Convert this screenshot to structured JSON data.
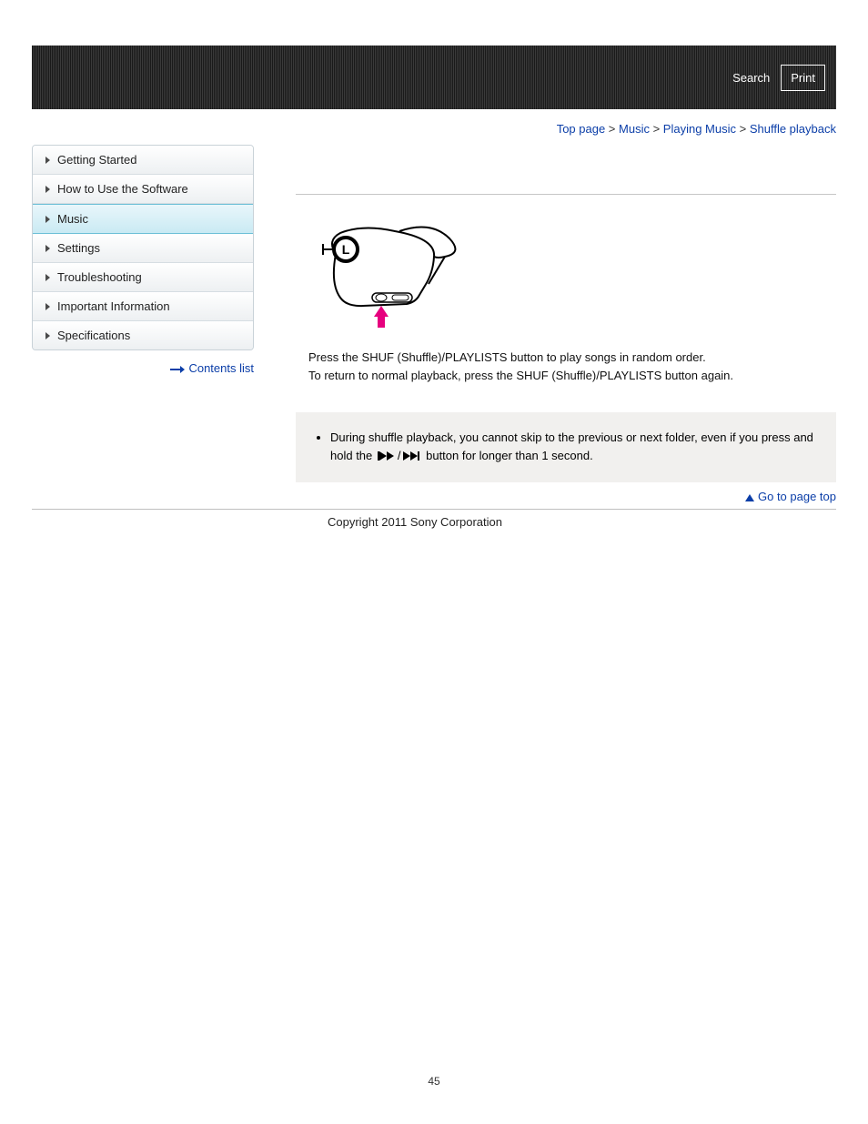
{
  "header": {
    "search_label": "Search",
    "print_label": "Print"
  },
  "breadcrumb": {
    "items": [
      "Top page",
      "Music",
      "Playing Music"
    ],
    "current": "Shuffle playback",
    "sep": " > "
  },
  "sidebar": {
    "items": [
      {
        "label": "Getting Started",
        "active": false
      },
      {
        "label": "How to Use the Software",
        "active": false
      },
      {
        "label": "Music",
        "active": true
      },
      {
        "label": "Settings",
        "active": false
      },
      {
        "label": "Troubleshooting",
        "active": false
      },
      {
        "label": "Important Information",
        "active": false
      },
      {
        "label": "Specifications",
        "active": false
      }
    ],
    "contents_link": "Contents list"
  },
  "content": {
    "line1": "Press the SHUF (Shuffle)/PLAYLISTS button to play songs in random order.",
    "line2": "To return to normal playback, press the SHUF (Shuffle)/PLAYLISTS button again.",
    "note_prefix": "During shuffle playback, you cannot skip to the previous or next folder, even if you press and hold the ",
    "note_suffix": " button for longer than 1 second."
  },
  "footer": {
    "go_top": "Go to page top",
    "copyright": "Copyright 2011 Sony Corporation"
  },
  "page_number": "45"
}
